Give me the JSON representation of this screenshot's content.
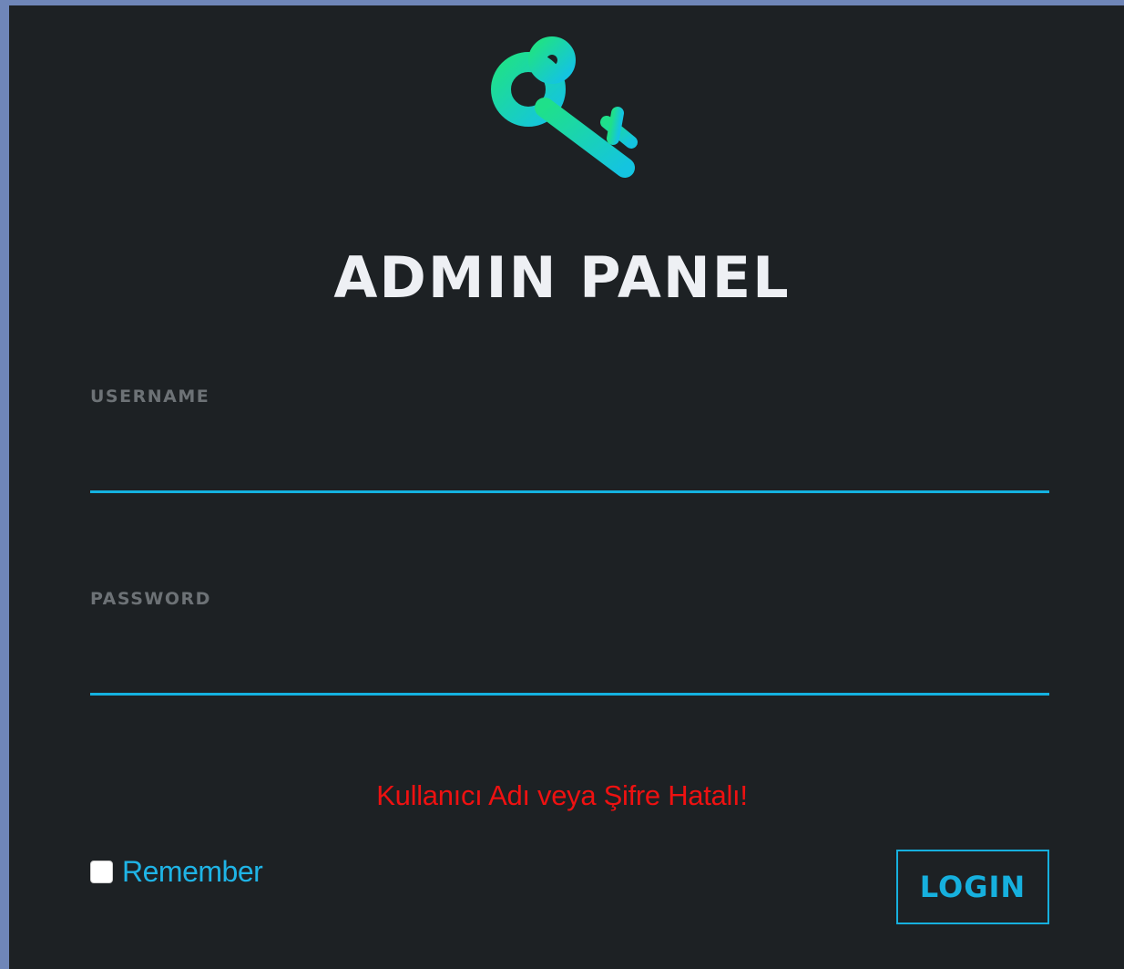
{
  "logo": {
    "icon": "key-icon",
    "gradient": [
      "#1fe08a",
      "#14c4e0"
    ]
  },
  "title": "ADMIN PANEL",
  "form": {
    "username": {
      "label": "USERNAME",
      "value": "",
      "placeholder": ""
    },
    "password": {
      "label": "PASSWORD",
      "value": "",
      "placeholder": ""
    }
  },
  "error_message": "Kullanıcı Adı veya Şifre Hatalı!",
  "remember": {
    "label": "Remember",
    "checked": false
  },
  "login_button": {
    "label": "LOGIN"
  },
  "colors": {
    "background": "#6f86b8",
    "panel": "#1d2124",
    "accent": "#14b2e0",
    "error": "#ee1111",
    "label": "#6d7276"
  }
}
